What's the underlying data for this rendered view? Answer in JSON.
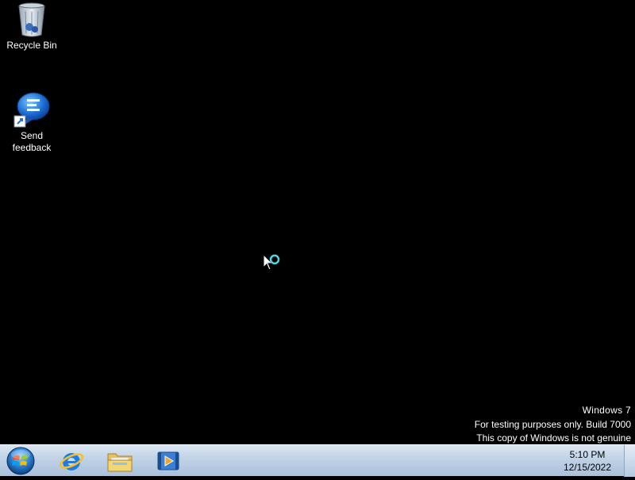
{
  "desktop": {
    "icons": [
      {
        "label": "Recycle Bin",
        "icon": "recycle-bin-icon"
      },
      {
        "label": "Send",
        "label2": "feedback",
        "icon": "send-feedback-icon"
      }
    ]
  },
  "watermark": {
    "line1": "Windows  7",
    "line2": "For testing purposes only. Build 7000",
    "line3": "This copy of Windows is not genuine"
  },
  "taskbar": {
    "start": {
      "icon": "windows-orb-icon"
    },
    "pinned": [
      {
        "icon": "internet-explorer-icon"
      },
      {
        "icon": "windows-explorer-icon"
      },
      {
        "icon": "media-player-icon"
      }
    ],
    "clock": {
      "time": "5:10 PM",
      "date": "12/15/2022"
    }
  },
  "colors": {
    "desktop_bg": "#000000",
    "taskbar_top": "#dbe6f2",
    "taskbar_bottom": "#a9c1dc",
    "busy_cursor_ring": "#4fd6e0"
  }
}
